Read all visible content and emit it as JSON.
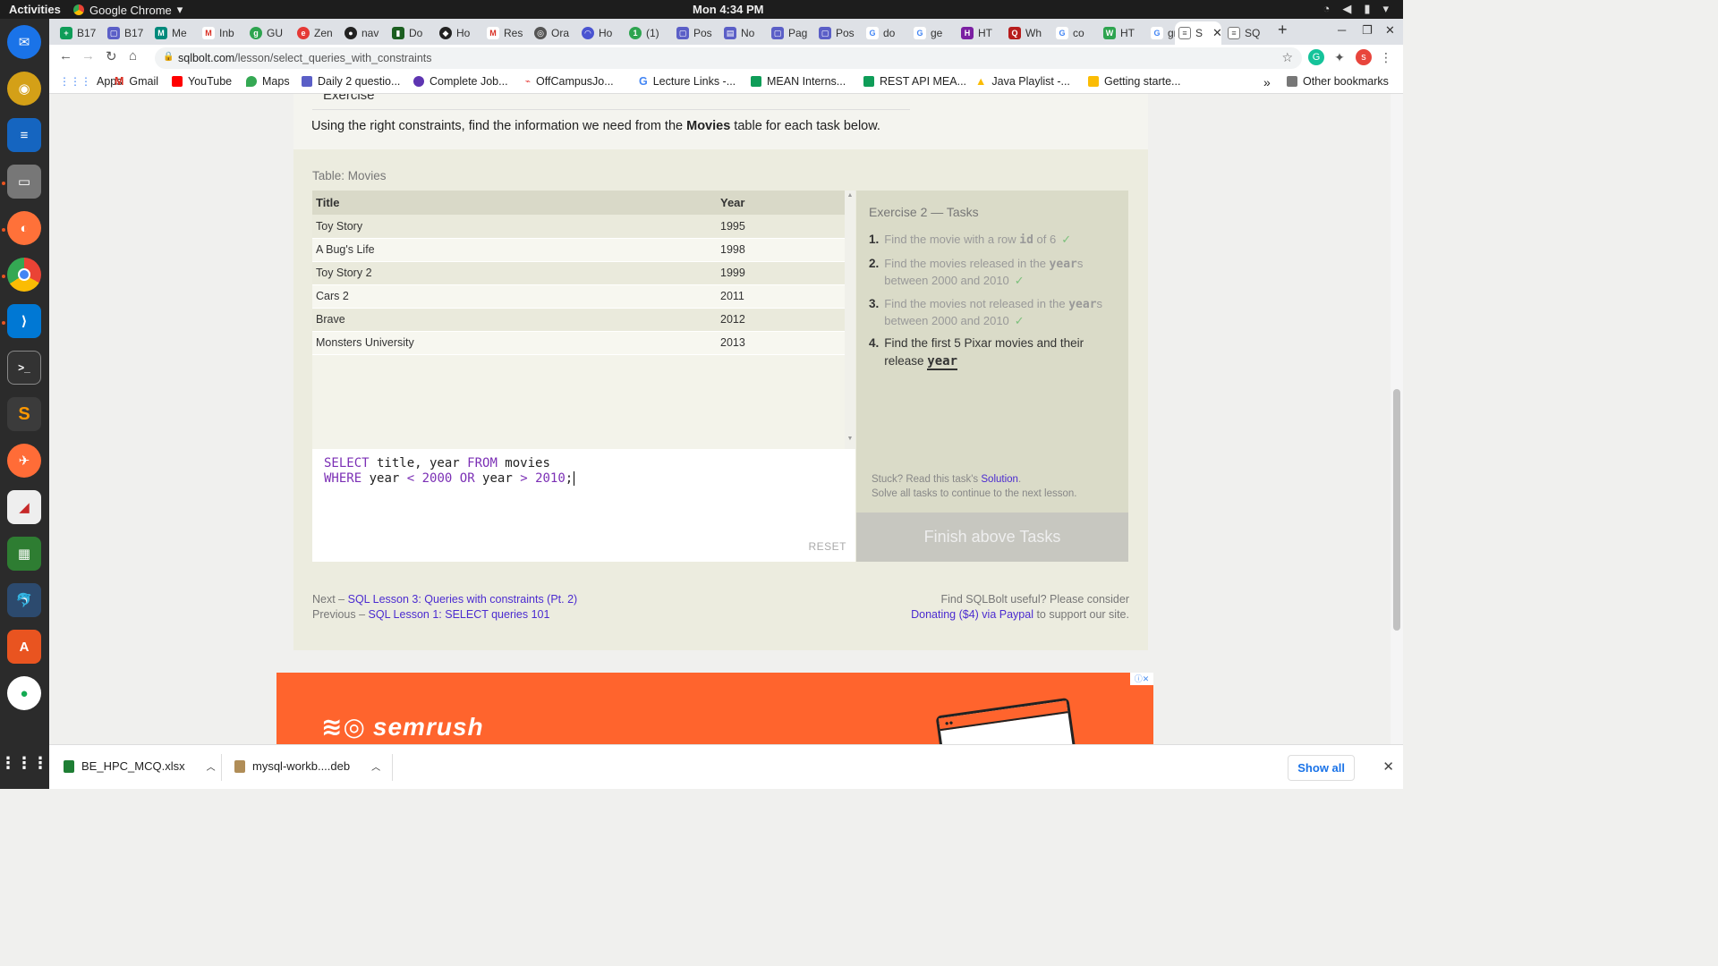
{
  "os": {
    "activities": "Activities",
    "app_name": "Google Chrome",
    "clock": "Mon  4:34 PM"
  },
  "tabs": [
    {
      "label": "B17",
      "color": "#0f9d58"
    },
    {
      "label": "B17",
      "color": "#5b5fc7"
    },
    {
      "label": "Me",
      "color": "#00897b"
    },
    {
      "label": "Inb",
      "color": "#d93025"
    },
    {
      "label": "GU",
      "color": "#2ea44f"
    },
    {
      "label": "Zen",
      "color": "#e53935"
    },
    {
      "label": "nav",
      "color": "#222222"
    },
    {
      "label": "Do",
      "color": "#1b5e20"
    },
    {
      "label": "Ho",
      "color": "#222222"
    },
    {
      "label": "Res",
      "color": "#d93025"
    },
    {
      "label": "Ora",
      "color": "#555555"
    },
    {
      "label": "Ho",
      "color": "#4a54d1"
    },
    {
      "label": "(1)",
      "color": "#2ea44f"
    },
    {
      "label": "Pos",
      "color": "#5b5fc7"
    },
    {
      "label": "No",
      "color": "#5b5fc7"
    },
    {
      "label": "Pag",
      "color": "#5b5fc7"
    },
    {
      "label": "Pos",
      "color": "#5b5fc7"
    },
    {
      "label": "do",
      "color": "#4285f4"
    },
    {
      "label": "ge",
      "color": "#4285f4"
    },
    {
      "label": "HT",
      "color": "#7b1fa2"
    },
    {
      "label": "Wh",
      "color": "#b71c1c"
    },
    {
      "label": "co",
      "color": "#4285f4"
    },
    {
      "label": "HT",
      "color": "#2ea44f"
    },
    {
      "label": "gra",
      "color": "#4285f4"
    },
    {
      "label": "S",
      "color": "#555555",
      "active": true
    },
    {
      "label": "SQ",
      "color": "#555555"
    }
  ],
  "address": {
    "domain": "sqlbolt.com",
    "path": "/lesson/select_queries_with_constraints"
  },
  "bookmarks": [
    {
      "label": "Apps",
      "color": "#4285f4"
    },
    {
      "label": "Gmail",
      "color": "#d93025"
    },
    {
      "label": "YouTube",
      "color": "#ff0000"
    },
    {
      "label": "Maps",
      "color": "#34a853"
    },
    {
      "label": "Daily 2 questio...",
      "color": "#5b5fc7"
    },
    {
      "label": "Complete Job...",
      "color": "#5e35b1"
    },
    {
      "label": "OffCampusJo...",
      "color": "#e53935"
    },
    {
      "label": "Lecture Links -...",
      "color": "#4285f4"
    },
    {
      "label": "MEAN Interns...",
      "color": "#0f9d58"
    },
    {
      "label": "REST API MEA...",
      "color": "#0f9d58"
    },
    {
      "label": "Java Playlist -...",
      "color": "#fbbc04"
    },
    {
      "label": "Getting starte...",
      "color": "#fbbc04"
    }
  ],
  "other_bookmarks": "Other bookmarks",
  "lesson": {
    "exercise_heading": "Exercise",
    "intro_before": "Using the right constraints, find the information we need from the ",
    "intro_bold": "Movies",
    "intro_after": " table for each task below.",
    "table_caption": "Table: Movies",
    "columns": [
      "Title",
      "Year"
    ],
    "rows": [
      [
        "Toy Story",
        "1995"
      ],
      [
        "A Bug's Life",
        "1998"
      ],
      [
        "Toy Story 2",
        "1999"
      ],
      [
        "Cars 2",
        "2011"
      ],
      [
        "Brave",
        "2012"
      ],
      [
        "Monsters University",
        "2013"
      ]
    ],
    "query_line1": [
      "SELECT",
      " title, year ",
      "FROM",
      " movies"
    ],
    "query_line2": [
      "WHERE",
      " year ",
      "<",
      " ",
      "2000",
      " ",
      "OR",
      " year ",
      ">",
      " ",
      "2010",
      ";"
    ],
    "reset_label": "RESET",
    "tasks_title": "Exercise 2 — Tasks",
    "tasks": [
      {
        "num": "1.",
        "before": "Find the movie with a row ",
        "code": "id",
        "after": " of 6",
        "done": true
      },
      {
        "num": "2.",
        "before": "Find the movies released in the ",
        "code": "year",
        "after": "s between 2000 and 2010",
        "done": true
      },
      {
        "num": "3.",
        "before": "Find the movies not released in the ",
        "code": "year",
        "after": "s between 2000 and 2010",
        "done": true
      },
      {
        "num": "4.",
        "before": "Find the first 5 Pixar movies and their release ",
        "code": "year",
        "after": "",
        "done": false
      }
    ],
    "stuck_text": "Stuck? Read this task's ",
    "solution_link": "Solution",
    "solve_all_text": "Solve all tasks to continue to the next lesson.",
    "finish_button": "Finish above Tasks",
    "next_prefix": "Next – ",
    "next_link": "SQL Lesson 3: Queries with constraints (Pt. 2)",
    "prev_prefix": "Previous – ",
    "prev_link": "SQL Lesson 1: SELECT queries 101",
    "donate_text": "Find SQLBolt useful? Please consider",
    "donate_link": "Donating ($4) via Paypal",
    "donate_after": " to support our site."
  },
  "ad": {
    "brand": "semrush"
  },
  "downloads": {
    "items": [
      "BE_HPC_MCQ.xlsx",
      "mysql-workb....deb"
    ],
    "show_all": "Show all"
  }
}
